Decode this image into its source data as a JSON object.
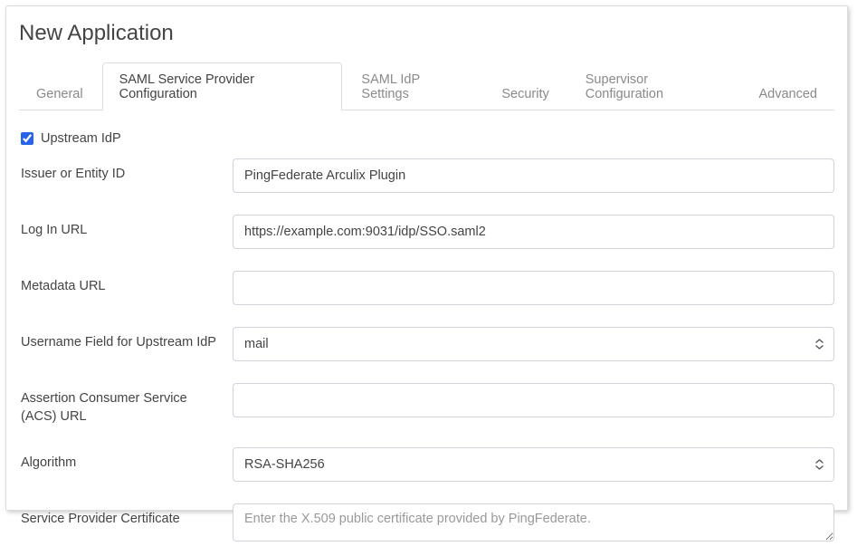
{
  "header": {
    "title": "New Application"
  },
  "tabs": {
    "items": [
      {
        "label": "General",
        "active": false
      },
      {
        "label": "SAML Service Provider Configuration",
        "active": true
      },
      {
        "label": "SAML IdP Settings",
        "active": false
      },
      {
        "label": "Security",
        "active": false
      },
      {
        "label": "Supervisor Configuration",
        "active": false
      },
      {
        "label": "Advanced",
        "active": false
      }
    ]
  },
  "form": {
    "upstream_idp": {
      "label": "Upstream IdP",
      "checked": true
    },
    "issuer": {
      "label": "Issuer or Entity ID",
      "value": "PingFederate Arculix Plugin"
    },
    "login_url": {
      "label": "Log In URL",
      "value": "https://example.com:9031/idp/SSO.saml2"
    },
    "metadata_url": {
      "label": "Metadata URL",
      "value": ""
    },
    "username_field": {
      "label": "Username Field for Upstream IdP",
      "value": "mail"
    },
    "acs_url": {
      "label": "Assertion Consumer Service (ACS) URL",
      "value": ""
    },
    "algorithm": {
      "label": "Algorithm",
      "value": "RSA-SHA256"
    },
    "sp_cert": {
      "label": "Service Provider Certificate",
      "placeholder": "Enter the X.509 public certificate provided by PingFederate."
    }
  }
}
